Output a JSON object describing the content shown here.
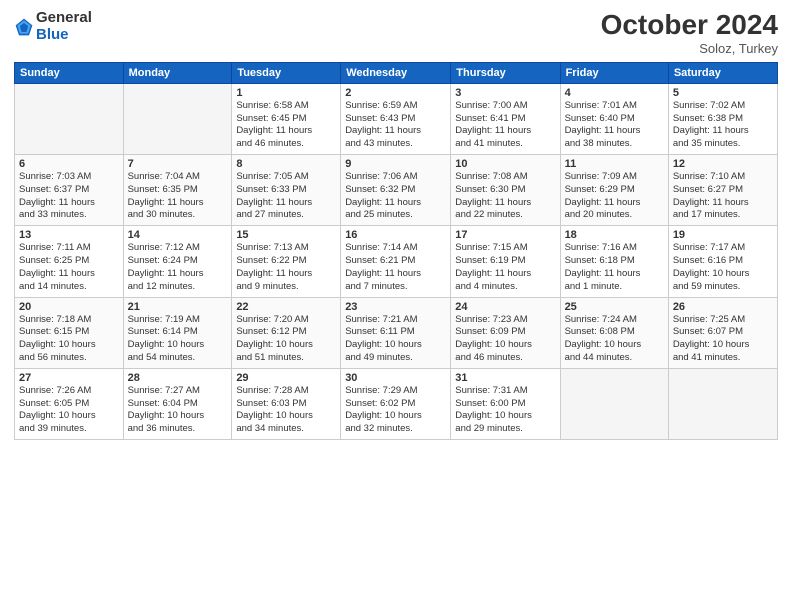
{
  "logo": {
    "general": "General",
    "blue": "Blue"
  },
  "title": "October 2024",
  "location": "Soloz, Turkey",
  "days_header": [
    "Sunday",
    "Monday",
    "Tuesday",
    "Wednesday",
    "Thursday",
    "Friday",
    "Saturday"
  ],
  "weeks": [
    [
      {
        "day": "",
        "info": ""
      },
      {
        "day": "",
        "info": ""
      },
      {
        "day": "1",
        "info": "Sunrise: 6:58 AM\nSunset: 6:45 PM\nDaylight: 11 hours\nand 46 minutes."
      },
      {
        "day": "2",
        "info": "Sunrise: 6:59 AM\nSunset: 6:43 PM\nDaylight: 11 hours\nand 43 minutes."
      },
      {
        "day": "3",
        "info": "Sunrise: 7:00 AM\nSunset: 6:41 PM\nDaylight: 11 hours\nand 41 minutes."
      },
      {
        "day": "4",
        "info": "Sunrise: 7:01 AM\nSunset: 6:40 PM\nDaylight: 11 hours\nand 38 minutes."
      },
      {
        "day": "5",
        "info": "Sunrise: 7:02 AM\nSunset: 6:38 PM\nDaylight: 11 hours\nand 35 minutes."
      }
    ],
    [
      {
        "day": "6",
        "info": "Sunrise: 7:03 AM\nSunset: 6:37 PM\nDaylight: 11 hours\nand 33 minutes."
      },
      {
        "day": "7",
        "info": "Sunrise: 7:04 AM\nSunset: 6:35 PM\nDaylight: 11 hours\nand 30 minutes."
      },
      {
        "day": "8",
        "info": "Sunrise: 7:05 AM\nSunset: 6:33 PM\nDaylight: 11 hours\nand 27 minutes."
      },
      {
        "day": "9",
        "info": "Sunrise: 7:06 AM\nSunset: 6:32 PM\nDaylight: 11 hours\nand 25 minutes."
      },
      {
        "day": "10",
        "info": "Sunrise: 7:08 AM\nSunset: 6:30 PM\nDaylight: 11 hours\nand 22 minutes."
      },
      {
        "day": "11",
        "info": "Sunrise: 7:09 AM\nSunset: 6:29 PM\nDaylight: 11 hours\nand 20 minutes."
      },
      {
        "day": "12",
        "info": "Sunrise: 7:10 AM\nSunset: 6:27 PM\nDaylight: 11 hours\nand 17 minutes."
      }
    ],
    [
      {
        "day": "13",
        "info": "Sunrise: 7:11 AM\nSunset: 6:25 PM\nDaylight: 11 hours\nand 14 minutes."
      },
      {
        "day": "14",
        "info": "Sunrise: 7:12 AM\nSunset: 6:24 PM\nDaylight: 11 hours\nand 12 minutes."
      },
      {
        "day": "15",
        "info": "Sunrise: 7:13 AM\nSunset: 6:22 PM\nDaylight: 11 hours\nand 9 minutes."
      },
      {
        "day": "16",
        "info": "Sunrise: 7:14 AM\nSunset: 6:21 PM\nDaylight: 11 hours\nand 7 minutes."
      },
      {
        "day": "17",
        "info": "Sunrise: 7:15 AM\nSunset: 6:19 PM\nDaylight: 11 hours\nand 4 minutes."
      },
      {
        "day": "18",
        "info": "Sunrise: 7:16 AM\nSunset: 6:18 PM\nDaylight: 11 hours\nand 1 minute."
      },
      {
        "day": "19",
        "info": "Sunrise: 7:17 AM\nSunset: 6:16 PM\nDaylight: 10 hours\nand 59 minutes."
      }
    ],
    [
      {
        "day": "20",
        "info": "Sunrise: 7:18 AM\nSunset: 6:15 PM\nDaylight: 10 hours\nand 56 minutes."
      },
      {
        "day": "21",
        "info": "Sunrise: 7:19 AM\nSunset: 6:14 PM\nDaylight: 10 hours\nand 54 minutes."
      },
      {
        "day": "22",
        "info": "Sunrise: 7:20 AM\nSunset: 6:12 PM\nDaylight: 10 hours\nand 51 minutes."
      },
      {
        "day": "23",
        "info": "Sunrise: 7:21 AM\nSunset: 6:11 PM\nDaylight: 10 hours\nand 49 minutes."
      },
      {
        "day": "24",
        "info": "Sunrise: 7:23 AM\nSunset: 6:09 PM\nDaylight: 10 hours\nand 46 minutes."
      },
      {
        "day": "25",
        "info": "Sunrise: 7:24 AM\nSunset: 6:08 PM\nDaylight: 10 hours\nand 44 minutes."
      },
      {
        "day": "26",
        "info": "Sunrise: 7:25 AM\nSunset: 6:07 PM\nDaylight: 10 hours\nand 41 minutes."
      }
    ],
    [
      {
        "day": "27",
        "info": "Sunrise: 7:26 AM\nSunset: 6:05 PM\nDaylight: 10 hours\nand 39 minutes."
      },
      {
        "day": "28",
        "info": "Sunrise: 7:27 AM\nSunset: 6:04 PM\nDaylight: 10 hours\nand 36 minutes."
      },
      {
        "day": "29",
        "info": "Sunrise: 7:28 AM\nSunset: 6:03 PM\nDaylight: 10 hours\nand 34 minutes."
      },
      {
        "day": "30",
        "info": "Sunrise: 7:29 AM\nSunset: 6:02 PM\nDaylight: 10 hours\nand 32 minutes."
      },
      {
        "day": "31",
        "info": "Sunrise: 7:31 AM\nSunset: 6:00 PM\nDaylight: 10 hours\nand 29 minutes."
      },
      {
        "day": "",
        "info": ""
      },
      {
        "day": "",
        "info": ""
      }
    ]
  ]
}
